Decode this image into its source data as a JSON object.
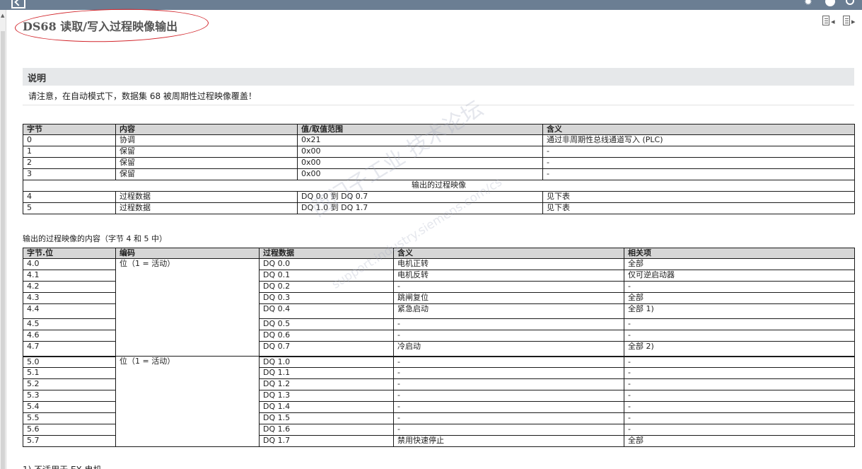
{
  "header": {
    "title": "DS68 读取/写入过程映像输出"
  },
  "section": {
    "heading": "说明",
    "note": "请注意，在自动模式下，数据集 68 被周期性过程映像覆盖！"
  },
  "table1": {
    "columns": [
      "字节",
      "内容",
      "值/取值范围",
      "含义"
    ],
    "rows_top": [
      [
        "0",
        "协调",
        "0x21",
        "通过非周期性总线通道写入 (PLC)"
      ],
      [
        "1",
        "保留",
        "0x00",
        "-"
      ],
      [
        "2",
        "保留",
        "0x00",
        "-"
      ],
      [
        "3",
        "保留",
        "0x00",
        "-"
      ]
    ],
    "span_label": "输出的过程映像",
    "rows_bottom": [
      [
        "4",
        "过程数据",
        "DQ 0.0 到 DQ 0.7",
        "见下表"
      ],
      [
        "5",
        "过程数据",
        "DQ 1.0 到 DQ 1.7",
        "见下表"
      ]
    ]
  },
  "table2": {
    "caption": "输出的过程映像的内容（字节 4 和 5 中）",
    "columns": [
      "字节.位",
      "编码",
      "过程数据",
      "含义",
      "相关项"
    ],
    "group_label_4": "位（1 = 活动）",
    "group_label_5": "位（1 = 活动）",
    "rows": [
      [
        "4.0",
        "DQ 0.0",
        "电机正转",
        "全部"
      ],
      [
        "4.1",
        "DQ 0.1",
        "电机反转",
        "仅可逆启动器"
      ],
      [
        "4.2",
        "DQ 0.2",
        "-",
        "-"
      ],
      [
        "4.3",
        "DQ 0.3",
        "跳闸复位",
        "全部"
      ],
      [
        "4.4",
        "DQ 0.4",
        "紧急启动",
        "全部 1)"
      ],
      [
        "4.5",
        "DQ 0.5",
        "-",
        "-"
      ],
      [
        "4.6",
        "DQ 0.6",
        "-",
        "-"
      ],
      [
        "4.7",
        "DQ 0.7",
        "冷启动",
        "全部 2)"
      ],
      [
        "5.0",
        "DQ 1.0",
        "-",
        "-"
      ],
      [
        "5.1",
        "DQ 1.1",
        "-",
        "-"
      ],
      [
        "5.2",
        "DQ 1.2",
        "-",
        "-"
      ],
      [
        "5.3",
        "DQ 1.3",
        "-",
        "-"
      ],
      [
        "5.4",
        "DQ 1.4",
        "-",
        "-"
      ],
      [
        "5.5",
        "DQ 1.5",
        "-",
        "-"
      ],
      [
        "5.6",
        "DQ 1.6",
        "-",
        "-"
      ],
      [
        "5.7",
        "DQ 1.7",
        "禁用快速停止",
        "全部"
      ]
    ]
  },
  "footnote": "1) 不适用于 EX 电机",
  "watermark": {
    "line1": "西门子工业  技术论坛",
    "line2": "support.industry.siemens.com/cs"
  },
  "colors": {
    "topbar": "#6b7e93",
    "annotation": "#d2242a",
    "header_bg": "#d6d6d6"
  },
  "icons": [
    "back-icon",
    "gear-icon",
    "help-icon",
    "search-icon",
    "prev-page-icon",
    "next-page-icon"
  ]
}
